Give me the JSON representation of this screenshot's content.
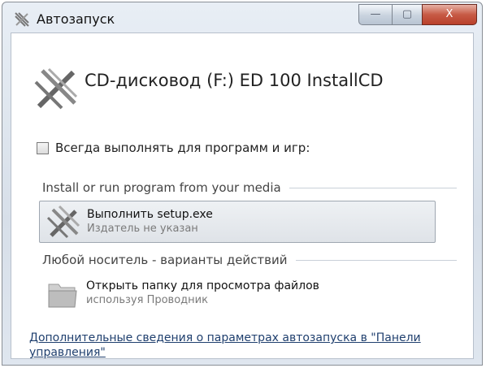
{
  "window": {
    "title": "Автозапуск",
    "minimize_glyph": "—",
    "maximize_glyph": "▢",
    "close_glyph": "X"
  },
  "drive": {
    "title": "CD-дисковод (F:) ED 100 InstallCD"
  },
  "always_do": {
    "label": "Всегда выполнять для программ и игр:",
    "checked": false
  },
  "sections": [
    {
      "header": "Install or run program from your media",
      "options": [
        {
          "title": "Выполнить setup.exe",
          "subtitle": "Издатель не указан",
          "icon": "installer-icon",
          "selected": true
        }
      ]
    },
    {
      "header": "Любой носитель - варианты действий",
      "options": [
        {
          "title": "Открыть папку для просмотра файлов",
          "subtitle": "используя Проводник",
          "icon": "folder-icon",
          "selected": false
        }
      ]
    }
  ],
  "more_info_link": "Дополнительные сведения о параметрах автозапуска в \"Панели управления\""
}
